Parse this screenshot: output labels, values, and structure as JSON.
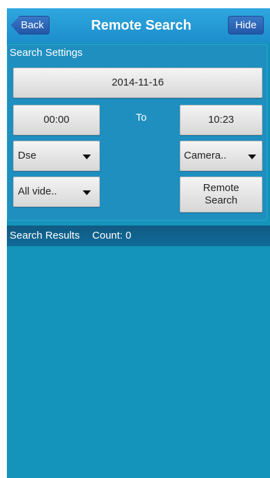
{
  "header": {
    "back_label": "Back",
    "title": "Remote Search",
    "hide_label": "Hide"
  },
  "settings": {
    "title": "Search Settings",
    "date": "2014-11-16",
    "start_time": "00:00",
    "to_label": "To",
    "end_time": "10:23",
    "device_select": "Dse",
    "camera_select": "Camera..",
    "video_type_select": "All vide..",
    "search_button_line1": "Remote",
    "search_button_line2": "Search"
  },
  "results": {
    "label": "Search Results",
    "count_label": "Count:",
    "count": "0"
  },
  "colors": {
    "background": "#1594bb",
    "header": "#2fa7de",
    "header_button": "#2356a8",
    "results_bar": "#115a82"
  }
}
